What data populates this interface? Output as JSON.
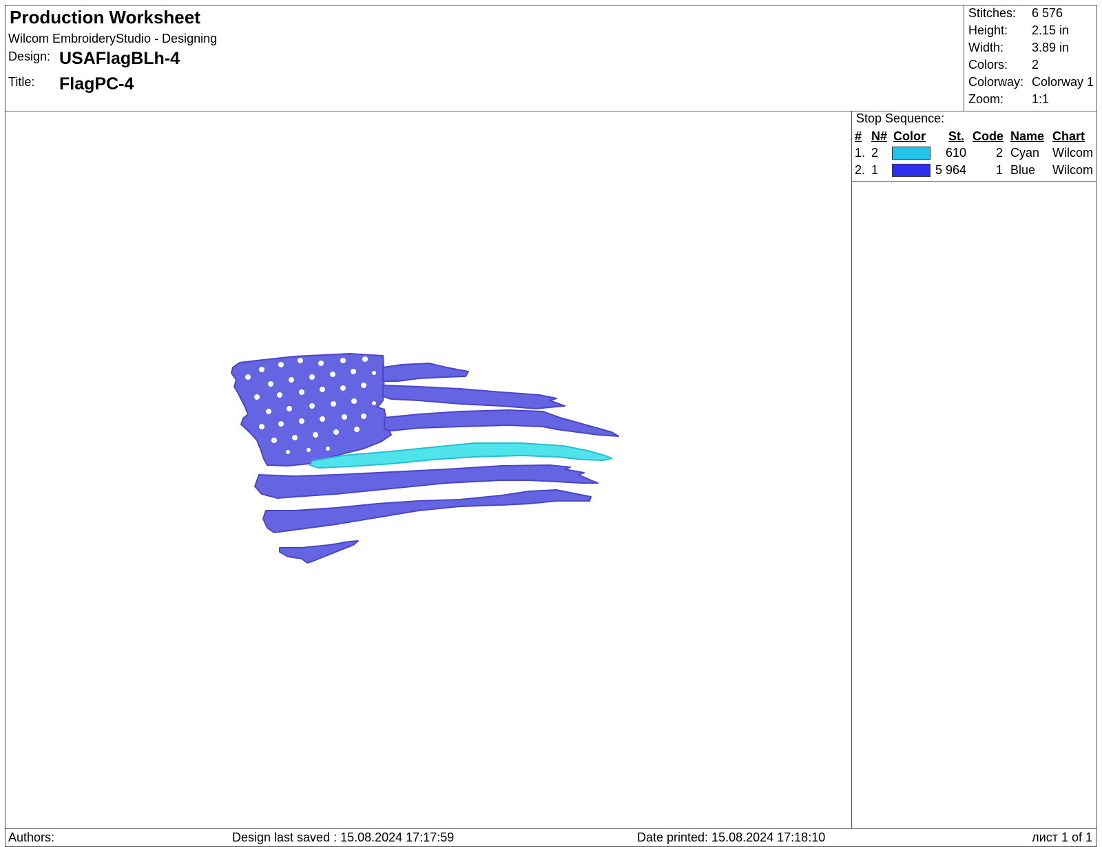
{
  "header": {
    "title": "Production Worksheet",
    "application": "Wilcom EmbroideryStudio - Designing",
    "design_label": "Design:",
    "design_value": "USAFlagBLh-4",
    "title_label": "Title:",
    "title_value": "FlagPC-4"
  },
  "stats": [
    {
      "label": "Stitches:",
      "value": "6 576"
    },
    {
      "label": "Height:",
      "value": "2.15 in"
    },
    {
      "label": "Width:",
      "value": "3.89 in"
    },
    {
      "label": "Colors:",
      "value": "2"
    },
    {
      "label": "Colorway:",
      "value": "Colorway 1"
    },
    {
      "label": "Zoom:",
      "value": "1:1"
    }
  ],
  "stop_sequence": {
    "title": "Stop Sequence:",
    "columns": [
      "#",
      "N#",
      "Color",
      "St.",
      "Code",
      "Name",
      "Chart"
    ],
    "rows": [
      {
        "index": "1.",
        "n": "2",
        "color": "#21c3e6",
        "stitches": "610",
        "code": "2",
        "name": "Cyan",
        "chart": "Wilcom"
      },
      {
        "index": "2.",
        "n": "1",
        "color": "#2d2dee",
        "stitches": "5 964",
        "code": "1",
        "name": "Blue",
        "chart": "Wilcom"
      }
    ]
  },
  "design_colors": {
    "blue_fill": "#6565e3",
    "blue_shade": "#4a46c8",
    "cyan_fill": "#4fe3ec",
    "cyan_shade": "#27bfd0"
  },
  "footer": {
    "authors": "Authors:",
    "last_saved": "Design last saved : 15.08.2024 17:17:59",
    "date_printed": "Date printed: 15.08.2024 17:18:10",
    "page": "лист 1 of 1"
  }
}
